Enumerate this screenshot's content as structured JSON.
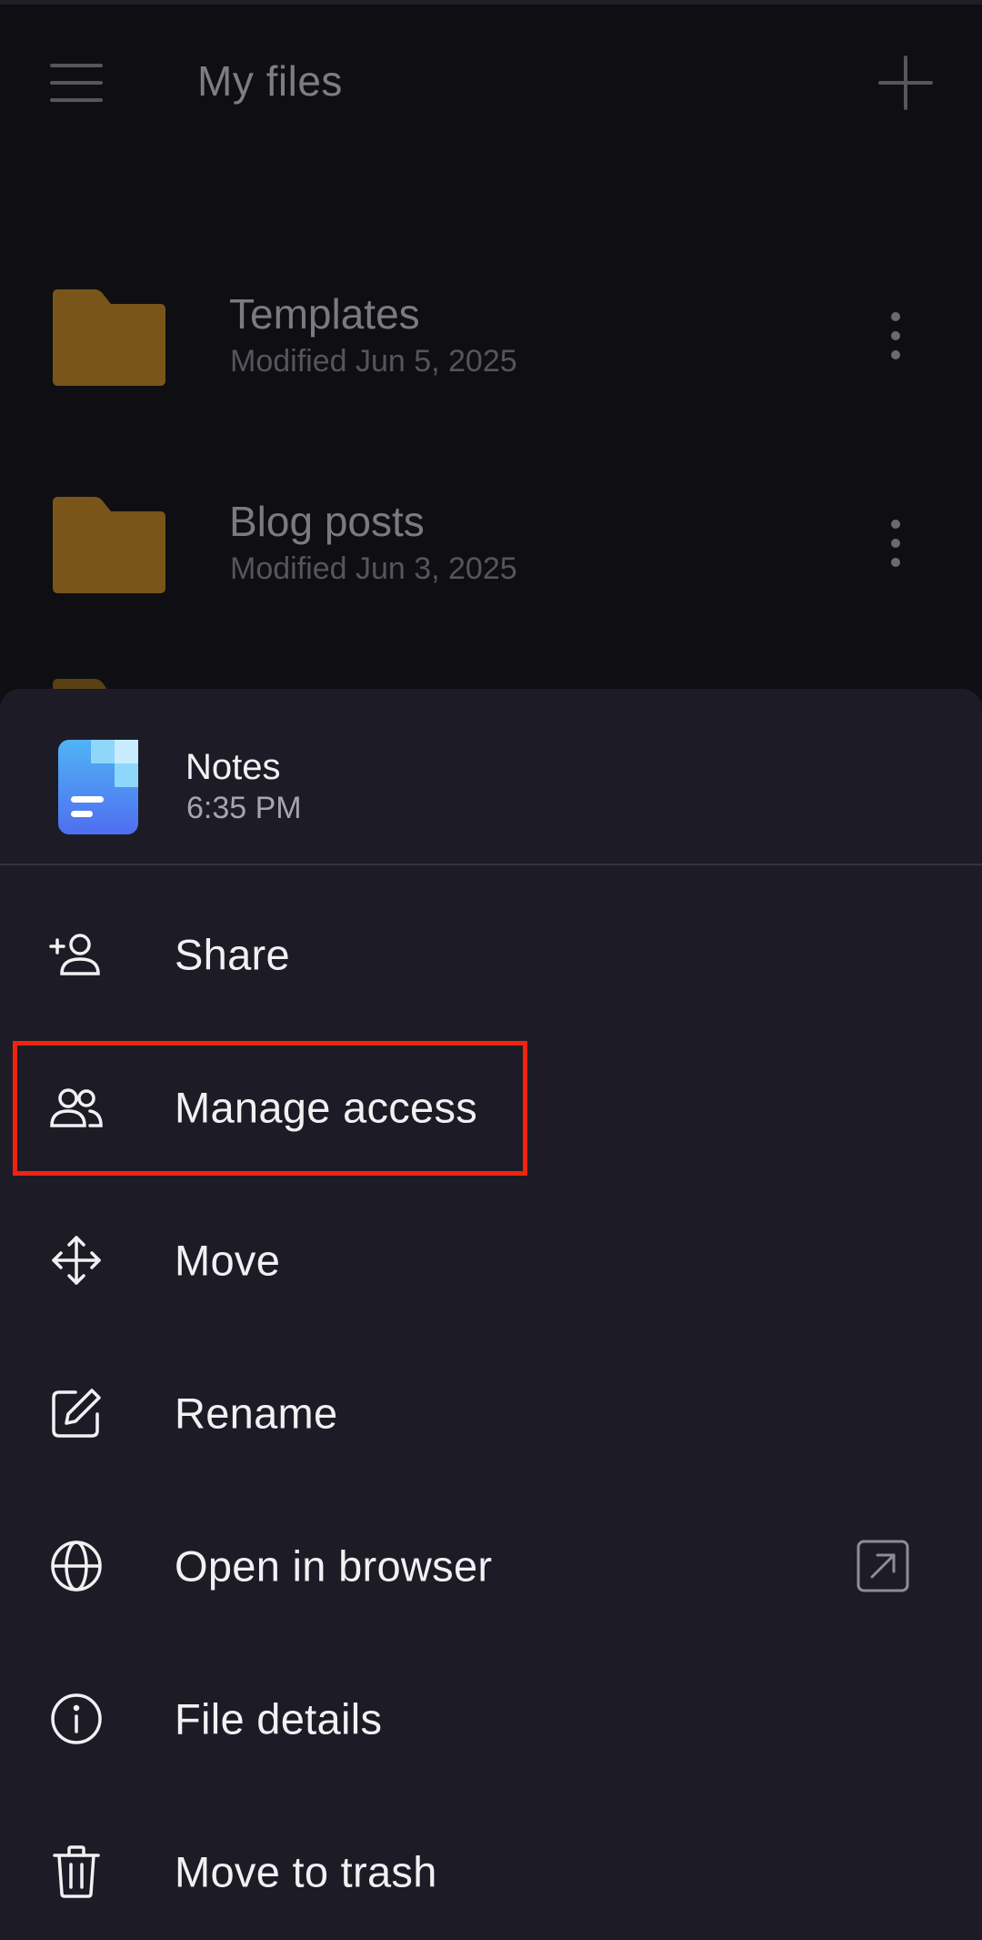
{
  "header": {
    "title": "My files",
    "menu_icon": "hamburger-menu-icon",
    "add_icon": "plus-icon"
  },
  "folders": [
    {
      "name": "Templates",
      "modified": "Modified Jun 5, 2025",
      "icon": "folder-icon",
      "color": "#7a5519"
    },
    {
      "name": "Blog posts",
      "modified": "Modified Jun 3, 2025",
      "icon": "folder-icon",
      "color": "#7a5519"
    }
  ],
  "sheet": {
    "file": {
      "name": "Notes",
      "time": "6:35 PM",
      "icon": "notes-file-icon"
    },
    "items": [
      {
        "label": "Share",
        "icon": "person-add-icon"
      },
      {
        "label": "Manage access",
        "icon": "people-icon"
      },
      {
        "label": "Move",
        "icon": "move-arrows-icon"
      },
      {
        "label": "Rename",
        "icon": "edit-icon"
      },
      {
        "label": "Open in browser",
        "icon": "globe-icon",
        "trailing_icon": "external-link-icon"
      },
      {
        "label": "File details",
        "icon": "info-icon"
      },
      {
        "label": "Move to trash",
        "icon": "trash-icon"
      }
    ]
  },
  "colors": {
    "background": "#0e0e13",
    "sheet": "#1d1c26",
    "highlight": "#f0230f",
    "folder": "#7a5519"
  }
}
